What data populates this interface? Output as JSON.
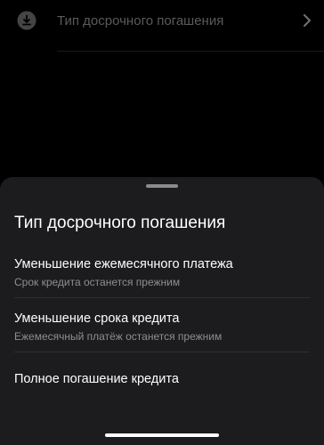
{
  "background": {
    "row_icon": "download-icon",
    "row_label": "Тип досрочного погашения",
    "row_chevron": "chevron-right-icon"
  },
  "sheet": {
    "title": "Тип досрочного погашения",
    "options": [
      {
        "title": "Уменьшение ежемесячного платежа",
        "subtitle": "Срок кредита останется прежним"
      },
      {
        "title": "Уменьшение срока кредита",
        "subtitle": "Ежемесячный платёж останется прежним"
      },
      {
        "title": "Полное погашение кредита"
      }
    ]
  },
  "colors": {
    "background": "#000000",
    "sheet": "#1c1c1e",
    "primary_text": "#ffffff",
    "secondary_text": "#8e8e93"
  }
}
